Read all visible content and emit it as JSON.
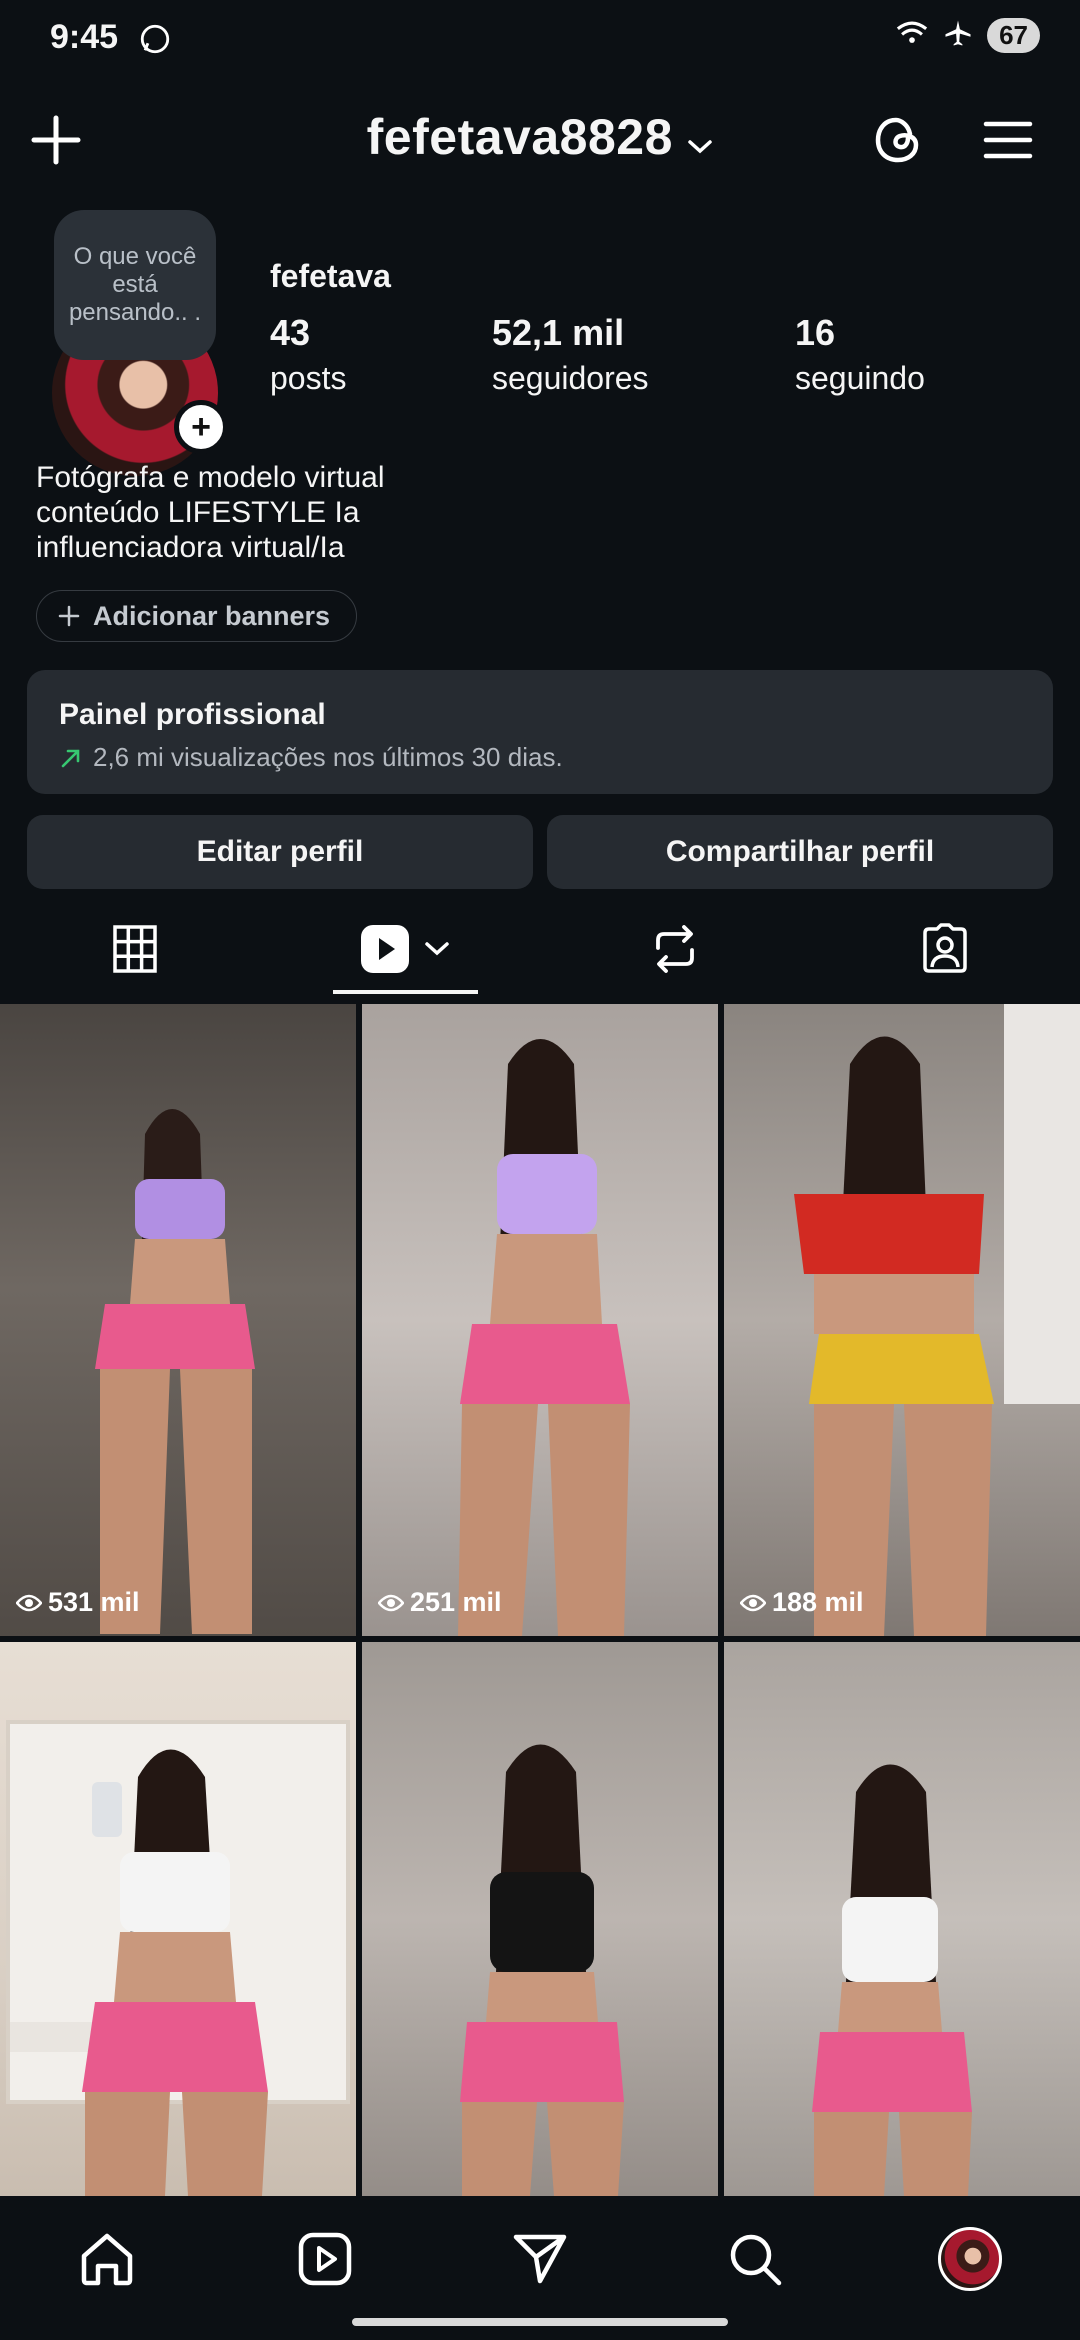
{
  "status_bar": {
    "time": "9:45",
    "battery": "67"
  },
  "header": {
    "username": "fefetava8828"
  },
  "profile": {
    "note": "O que você está pensando.. .",
    "display_name": "fefetava",
    "stats": [
      {
        "value": "43",
        "label": "posts"
      },
      {
        "value": "52,1 mil",
        "label": "seguidores"
      },
      {
        "value": "16",
        "label": "seguindo"
      }
    ],
    "bio_lines": [
      "Fotógrafa e modelo virtual",
      "conteúdo LIFESTYLE Ia",
      "influenciadora virtual/Ia"
    ],
    "add_banners": "Adicionar banners"
  },
  "pro_panel": {
    "title": "Painel profissional",
    "subtitle": "2,6 mi visualizações nos últimos 30 dias."
  },
  "actions": {
    "edit": "Editar perfil",
    "share": "Compartilhar perfil"
  },
  "tabs": [
    "grid-icon",
    "reels-icon",
    "reposts-icon",
    "tagged-icon"
  ],
  "grid": {
    "items": [
      {
        "views": "531 mil"
      },
      {
        "views": "251 mil"
      },
      {
        "views": "188 mil"
      },
      {
        "views": ""
      },
      {
        "views": ""
      },
      {
        "views": ""
      }
    ]
  },
  "nav": [
    "home-icon",
    "reels-icon",
    "messages-icon",
    "search-icon",
    "profile-avatar"
  ],
  "colors": {
    "background": "#0c1014",
    "panel": "#262b31",
    "accent_green": "#37c871"
  }
}
